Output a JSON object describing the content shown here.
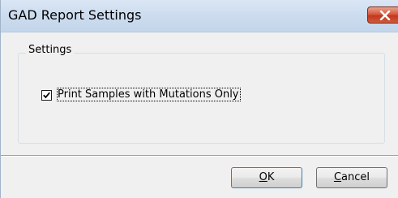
{
  "window": {
    "title": "GAD Report Settings"
  },
  "settings_group": {
    "label": "Settings",
    "checkbox": {
      "label": "Print Samples with Mutations Only",
      "checked": true
    }
  },
  "buttons": {
    "ok": {
      "mnemonic": "O",
      "rest": "K"
    },
    "cancel": {
      "mnemonic": "C",
      "rest": "ancel"
    }
  },
  "icons": {
    "close": "close-icon",
    "checkmark": "checkmark-icon"
  },
  "colors": {
    "close_button": "#c2381f",
    "window_background": "#f0f0f0",
    "titlebar": "#cdddef"
  }
}
